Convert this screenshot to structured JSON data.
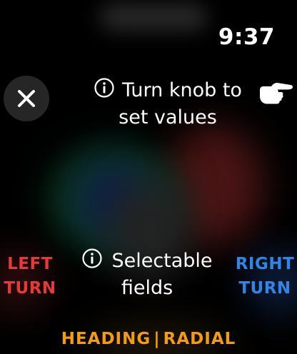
{
  "status": {
    "time": "9:37"
  },
  "overlay": {
    "knob_hint_line1": "Turn knob to",
    "knob_hint_line2": "set values",
    "select_hint_line1": "Selectable",
    "select_hint_line2": "fields"
  },
  "controls": {
    "left_turn_line1": "LEFT",
    "left_turn_line2": "TURN",
    "right_turn_line1": "RIGHT",
    "right_turn_line2": "TURN"
  },
  "footer": {
    "heading_label": "HEADING",
    "separator": "|",
    "radial_label": "RADIAL"
  },
  "icons": {
    "close": "close-icon",
    "info": "info-icon",
    "hand": "hand-pointing-right-icon"
  },
  "colors": {
    "background": "#000000",
    "left_turn": "#e53a3a",
    "right_turn": "#2f86e6",
    "footer": "#f39c12",
    "close_button_bg": "#262626"
  }
}
